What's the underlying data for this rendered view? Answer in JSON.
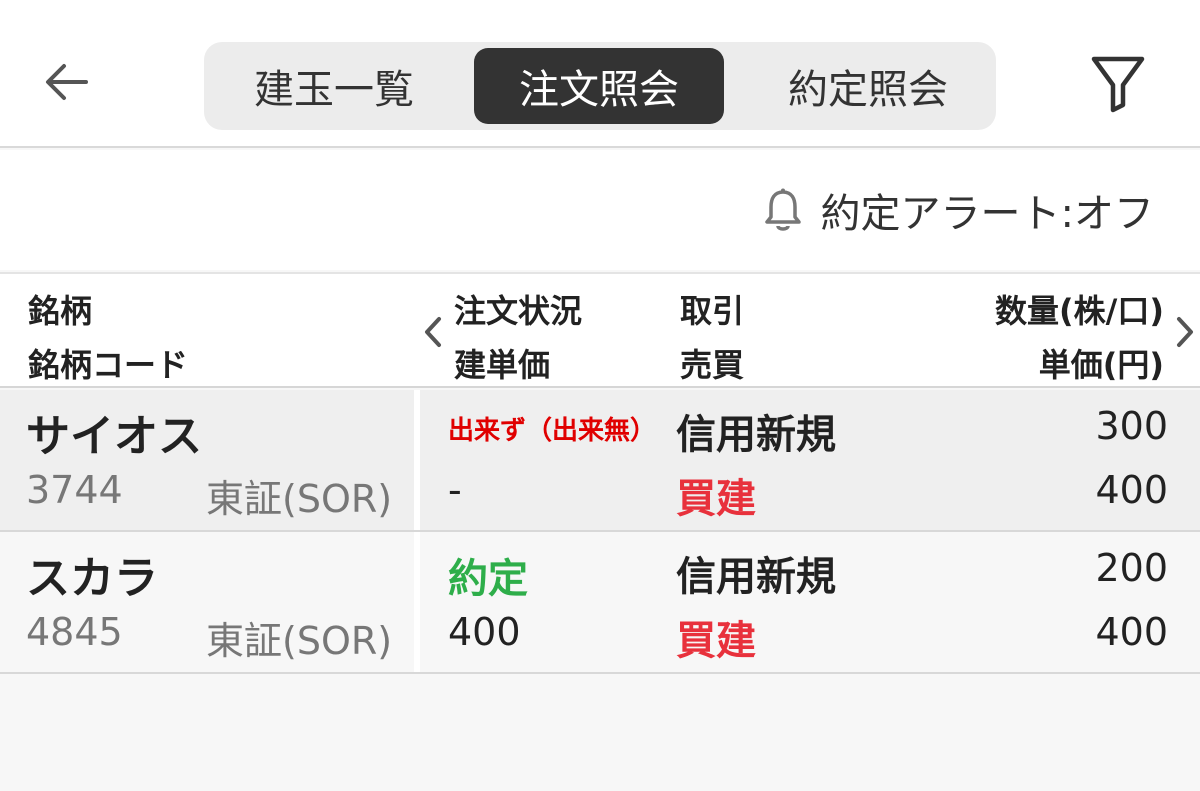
{
  "header": {
    "tabs": [
      {
        "label": "建玉一覧",
        "active": false
      },
      {
        "label": "注文照会",
        "active": true
      },
      {
        "label": "約定照会",
        "active": false
      }
    ],
    "back_icon": "arrow-left-icon",
    "filter_icon": "filter-icon"
  },
  "alert": {
    "icon": "bell-icon",
    "label": "約定アラート:オフ"
  },
  "table": {
    "headers": {
      "col1_line1": "銘柄",
      "col1_line2": "銘柄コード",
      "col2_line1": "注文状況",
      "col2_line2": "建単価",
      "col3_line1": "取引",
      "col3_line2": "売買",
      "col4_line1": "数量(株/口)",
      "col4_line2": "単価(円)"
    },
    "rows": [
      {
        "name": "サイオス",
        "code": "3744",
        "market": "東証(SOR)",
        "status": "出来ず（出来無）",
        "status_color": "#e00000",
        "build_price": "-",
        "trade": "信用新規",
        "side": "買建",
        "quantity": "300",
        "unit_price": "400"
      },
      {
        "name": "スカラ",
        "code": "4845",
        "market": "東証(SOR)",
        "status": "約定",
        "status_color": "#2eae4a",
        "build_price": "400",
        "trade": "信用新規",
        "side": "買建",
        "quantity": "200",
        "unit_price": "400"
      }
    ]
  },
  "colors": {
    "active_tab_bg": "#333333",
    "buy_side": "#e8313c",
    "row1_bg": "#efefef",
    "row2_bg": "#f7f7f7"
  }
}
